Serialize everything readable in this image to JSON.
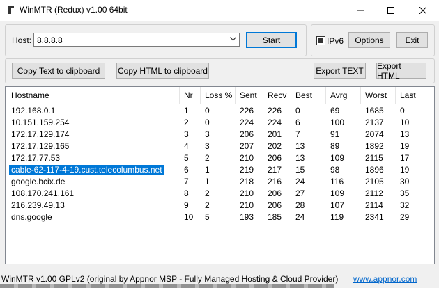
{
  "window": {
    "title": "WinMTR (Redux) v1.00 64bit"
  },
  "host": {
    "label": "Host:",
    "value": "8.8.8.8"
  },
  "buttons": {
    "start": "Start",
    "options": "Options",
    "exit": "Exit",
    "copy_text": "Copy Text to clipboard",
    "copy_html": "Copy HTML to clipboard",
    "export_text": "Export TEXT",
    "export_html": "Export HTML"
  },
  "ipv6": {
    "label": "IPv6",
    "checked": true
  },
  "table": {
    "columns": [
      "Hostname",
      "Nr",
      "Loss %",
      "Sent",
      "Recv",
      "Best",
      "Avrg",
      "Worst",
      "Last"
    ],
    "selected_row": 5,
    "rows": [
      [
        "192.168.0.1",
        "1",
        "0",
        "226",
        "226",
        "0",
        "69",
        "1685",
        "0"
      ],
      [
        "10.151.159.254",
        "2",
        "0",
        "224",
        "224",
        "6",
        "100",
        "2137",
        "10"
      ],
      [
        "172.17.129.174",
        "3",
        "3",
        "206",
        "201",
        "7",
        "91",
        "2074",
        "13"
      ],
      [
        "172.17.129.165",
        "4",
        "3",
        "207",
        "202",
        "13",
        "89",
        "1892",
        "19"
      ],
      [
        "172.17.77.53",
        "5",
        "2",
        "210",
        "206",
        "13",
        "109",
        "2115",
        "17"
      ],
      [
        "cable-62-117-4-19.cust.telecolumbus.net",
        "6",
        "1",
        "219",
        "217",
        "15",
        "98",
        "1896",
        "19"
      ],
      [
        "google.bcix.de",
        "7",
        "1",
        "218",
        "216",
        "24",
        "116",
        "2105",
        "30"
      ],
      [
        "108.170.241.161",
        "8",
        "2",
        "210",
        "206",
        "27",
        "109",
        "2112",
        "35"
      ],
      [
        "216.239.49.13",
        "9",
        "2",
        "210",
        "206",
        "28",
        "107",
        "2114",
        "32"
      ],
      [
        "dns.google",
        "10",
        "5",
        "193",
        "185",
        "24",
        "119",
        "2341",
        "29"
      ]
    ]
  },
  "status": {
    "text": "WinMTR v1.00 GPLv2 (original by Appnor MSP - Fully Managed Hosting & Cloud Provider)",
    "link": "www.appnor.com"
  },
  "colors": {
    "selection": "#0078d7",
    "link": "#0066cc"
  }
}
